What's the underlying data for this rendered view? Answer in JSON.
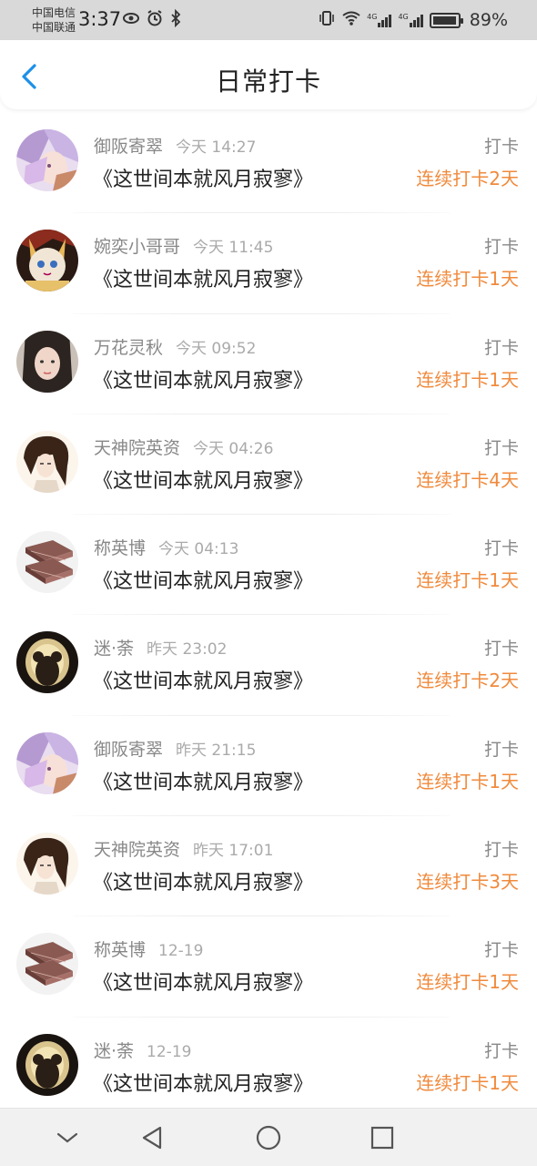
{
  "status_bar": {
    "carrier1": "中国电信",
    "carrier2": "中国联通",
    "time": "3:37",
    "network1": "4G",
    "network2": "4G",
    "battery": "89%"
  },
  "header": {
    "title": "日常打卡"
  },
  "entries": [
    {
      "name": "御阪寄翠",
      "time": "今天 14:27",
      "book": "《这世间本就风月寂寥》",
      "action": "打卡",
      "streak": "连续打卡2天",
      "avatar": "anime-purple"
    },
    {
      "name": "婉奕小哥哥",
      "time": "今天 11:45",
      "book": "《这世间本就风月寂寥》",
      "action": "打卡",
      "streak": "连续打卡1天",
      "avatar": "cat-doll"
    },
    {
      "name": "万花灵秋",
      "time": "今天 09:52",
      "book": "《这世间本就风月寂寥》",
      "action": "打卡",
      "streak": "连续打卡1天",
      "avatar": "girl-photo"
    },
    {
      "name": "天神院英资",
      "time": "今天 04:26",
      "book": "《这世间本就风月寂寥》",
      "action": "打卡",
      "streak": "连续打卡4天",
      "avatar": "anime-brown-hair"
    },
    {
      "name": "称英博",
      "time": "今天 04:13",
      "book": "《这世间本就风月寂寥》",
      "action": "打卡",
      "streak": "连续打卡1天",
      "avatar": "book-stack"
    },
    {
      "name": "迷·荼",
      "time": "昨天 23:02",
      "book": "《这世间本就风月寂寥》",
      "action": "打卡",
      "streak": "连续打卡2天",
      "avatar": "bear-window"
    },
    {
      "name": "御阪寄翠",
      "time": "昨天 21:15",
      "book": "《这世间本就风月寂寥》",
      "action": "打卡",
      "streak": "连续打卡1天",
      "avatar": "anime-purple"
    },
    {
      "name": "天神院英资",
      "time": "昨天 17:01",
      "book": "《这世间本就风月寂寥》",
      "action": "打卡",
      "streak": "连续打卡3天",
      "avatar": "anime-brown-hair"
    },
    {
      "name": "称英博",
      "time": "12-19",
      "book": "《这世间本就风月寂寥》",
      "action": "打卡",
      "streak": "连续打卡1天",
      "avatar": "book-stack"
    },
    {
      "name": "迷·荼",
      "time": "12-19",
      "book": "《这世间本就风月寂寥》",
      "action": "打卡",
      "streak": "连续打卡1天",
      "avatar": "bear-window"
    }
  ],
  "colors": {
    "accent_orange": "#f08a3c",
    "back_blue": "#1e90e8"
  }
}
